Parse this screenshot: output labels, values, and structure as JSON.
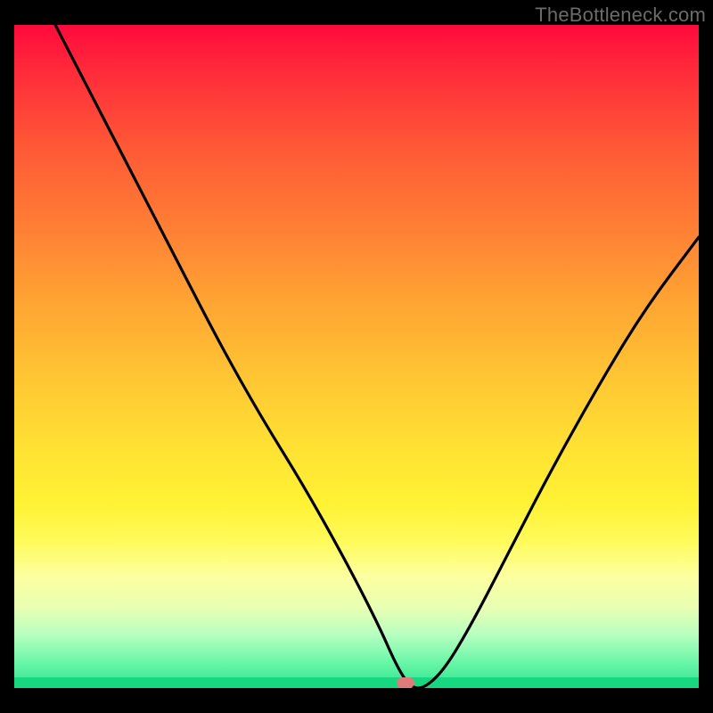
{
  "watermark": "TheBottleneck.com",
  "marker": {
    "x_frac": 0.572,
    "y_frac": 0.994
  },
  "chart_data": {
    "type": "line",
    "title": "",
    "xlabel": "",
    "ylabel": "",
    "xlim": [
      0,
      1
    ],
    "ylim": [
      0,
      1
    ],
    "series": [
      {
        "name": "curve",
        "x": [
          0.06,
          0.12,
          0.18,
          0.24,
          0.3,
          0.36,
          0.42,
          0.48,
          0.53,
          0.56,
          0.58,
          0.6,
          0.63,
          0.67,
          0.72,
          0.78,
          0.85,
          0.92,
          1.0
        ],
        "y": [
          1.0,
          0.88,
          0.76,
          0.64,
          0.52,
          0.41,
          0.31,
          0.2,
          0.1,
          0.03,
          0.0,
          0.0,
          0.03,
          0.1,
          0.2,
          0.32,
          0.45,
          0.57,
          0.68
        ]
      }
    ],
    "background_gradient": {
      "orientation": "vertical",
      "stops": [
        {
          "pos": 0.0,
          "color": "#ff0a3c"
        },
        {
          "pos": 0.3,
          "color": "#ff7d34"
        },
        {
          "pos": 0.6,
          "color": "#ffe233"
        },
        {
          "pos": 0.83,
          "color": "#fdff9e"
        },
        {
          "pos": 1.0,
          "color": "#17d781"
        }
      ]
    },
    "marker_point": {
      "x": 0.572,
      "y": 0.0,
      "color": "#e07b7b"
    }
  }
}
